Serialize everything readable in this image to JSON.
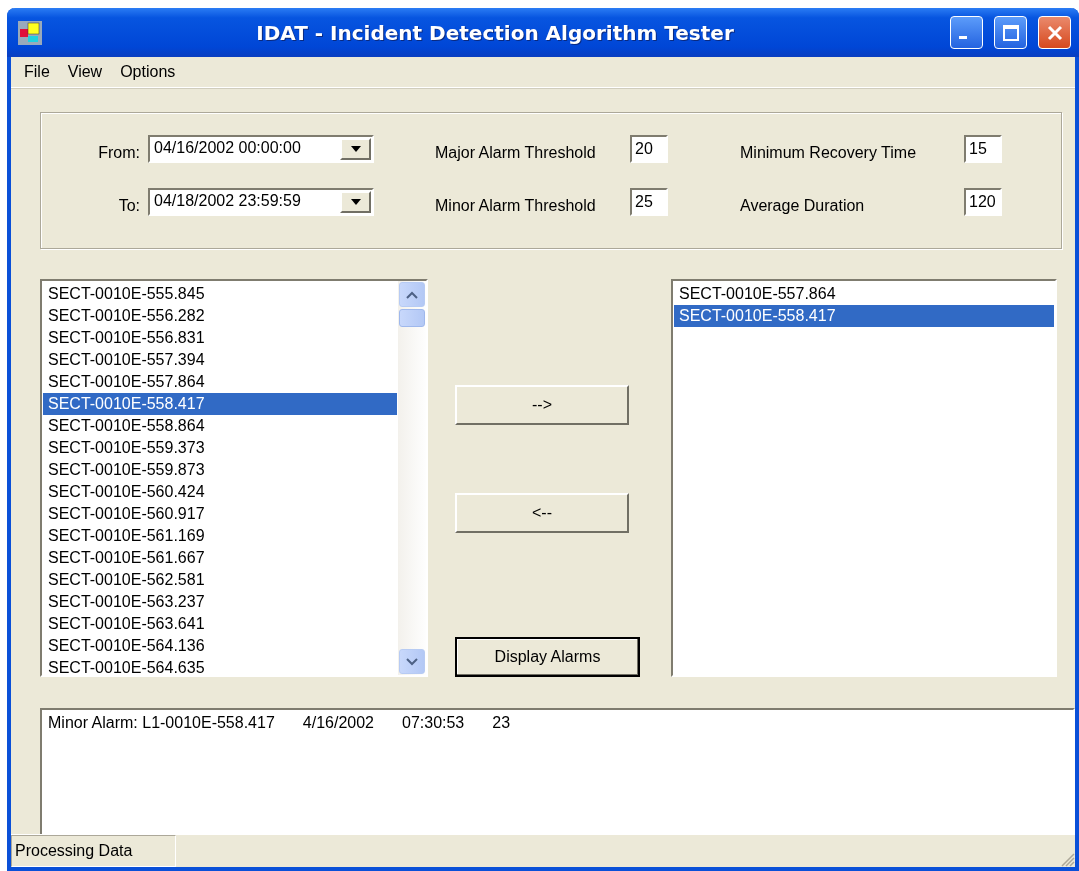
{
  "window": {
    "title": "IDAT - Incident Detection Algorithm Tester"
  },
  "menu": [
    "File",
    "View",
    "Options"
  ],
  "date_range": [
    {
      "label": "From:",
      "value": "04/16/2002 00:00:00"
    },
    {
      "label": "To:",
      "value": "04/18/2002 23:59:59"
    }
  ],
  "thresholds": [
    {
      "label": "Major Alarm Threshold",
      "value": "20"
    },
    {
      "label": "Minor Alarm Threshold",
      "value": "25"
    }
  ],
  "timing": [
    {
      "label": "Minimum Recovery Time",
      "value": "15"
    },
    {
      "label": "Average Duration",
      "value": "120"
    }
  ],
  "available_sections": [
    {
      "label": "SECT-0010E-555.845",
      "selected": false
    },
    {
      "label": "SECT-0010E-556.282",
      "selected": false
    },
    {
      "label": "SECT-0010E-556.831",
      "selected": false
    },
    {
      "label": "SECT-0010E-557.394",
      "selected": false
    },
    {
      "label": "SECT-0010E-557.864",
      "selected": false
    },
    {
      "label": "SECT-0010E-558.417",
      "selected": true
    },
    {
      "label": "SECT-0010E-558.864",
      "selected": false
    },
    {
      "label": "SECT-0010E-559.373",
      "selected": false
    },
    {
      "label": "SECT-0010E-559.873",
      "selected": false
    },
    {
      "label": "SECT-0010E-560.424",
      "selected": false
    },
    {
      "label": "SECT-0010E-560.917",
      "selected": false
    },
    {
      "label": "SECT-0010E-561.169",
      "selected": false
    },
    {
      "label": "SECT-0010E-561.667",
      "selected": false
    },
    {
      "label": "SECT-0010E-562.581",
      "selected": false
    },
    {
      "label": "SECT-0010E-563.237",
      "selected": false
    },
    {
      "label": "SECT-0010E-563.641",
      "selected": false
    },
    {
      "label": "SECT-0010E-564.136",
      "selected": false
    },
    {
      "label": "SECT-0010E-564.635",
      "selected": false
    }
  ],
  "add_button": "-->",
  "remove_button": "<--",
  "display_button": "Display Alarms",
  "selected_sections": [
    {
      "label": "SECT-0010E-557.864",
      "selected": false
    },
    {
      "label": "SECT-0010E-558.417",
      "selected": true
    }
  ],
  "alarms": [
    {
      "cells": [
        "Minor Alarm: L1-0010E-558.417",
        "4/16/2002",
        "07:30:53",
        "23"
      ]
    }
  ],
  "status_bar": "Processing Data"
}
